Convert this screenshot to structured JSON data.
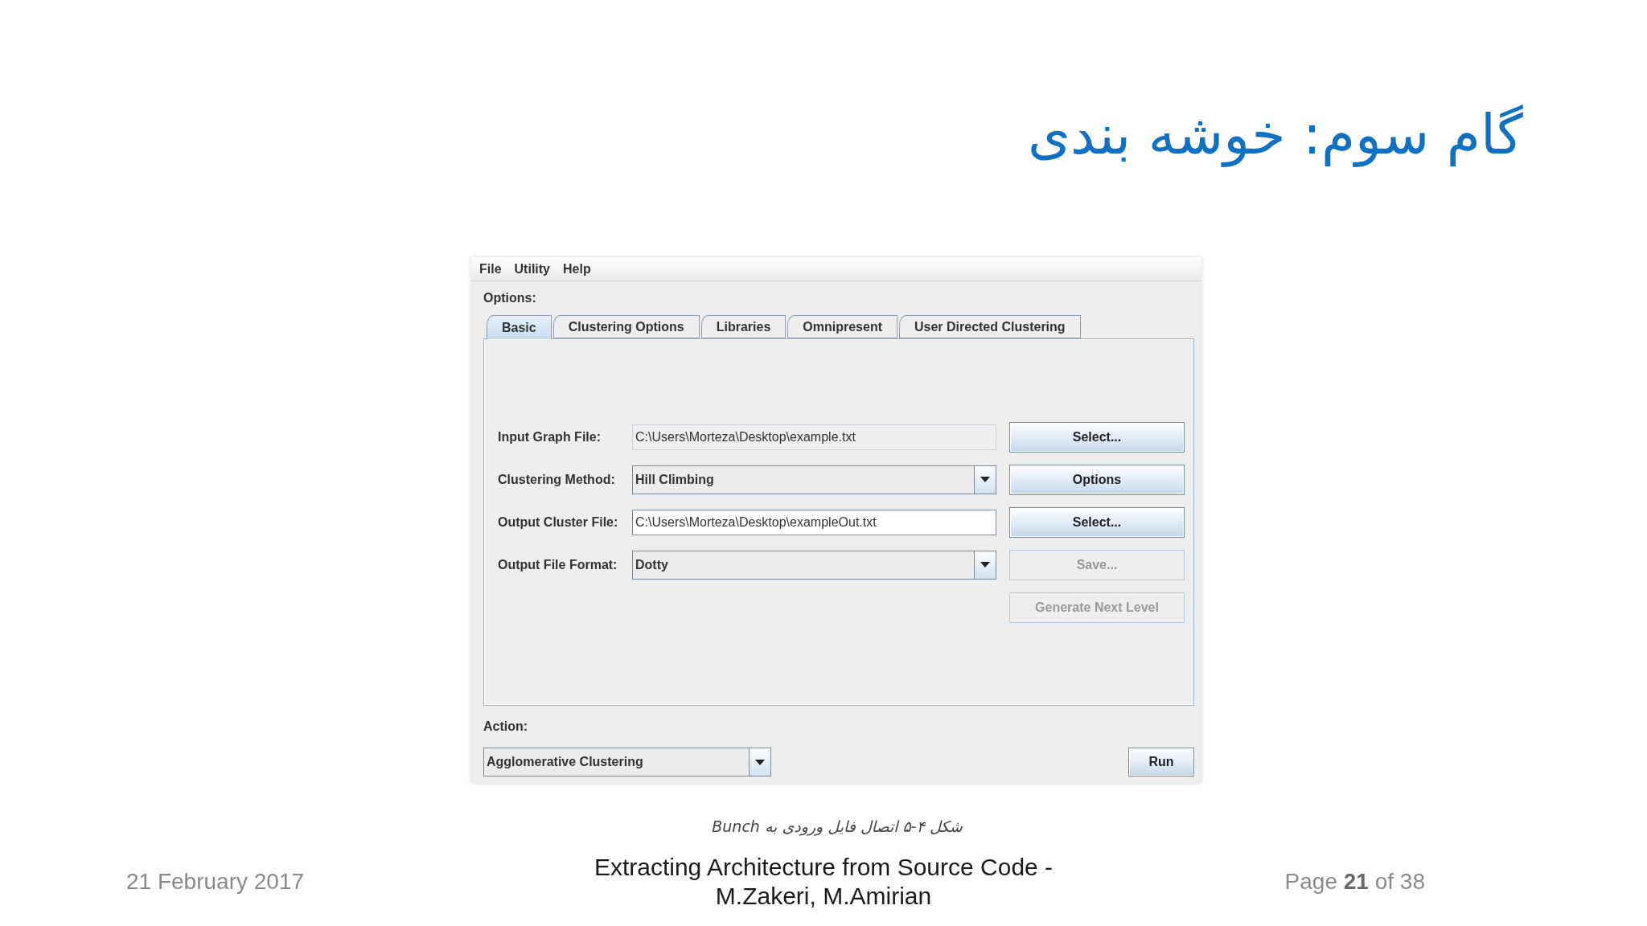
{
  "title": "گام سوم: خوشه بندی",
  "window": {
    "menu": [
      "File",
      "Utility",
      "Help"
    ],
    "options_label": "Options:",
    "tabs": [
      {
        "label": "Basic",
        "selected": true
      },
      {
        "label": "Clustering Options",
        "selected": false
      },
      {
        "label": "Libraries",
        "selected": false
      },
      {
        "label": "Omnipresent",
        "selected": false
      },
      {
        "label": "User Directed Clustering",
        "selected": false
      }
    ],
    "form_rows": [
      {
        "kind": "text",
        "label": "Input Graph File:",
        "value": "C:\\Users\\Morteza\\Desktop\\example.txt",
        "editable": false,
        "button": {
          "label": "Select...",
          "disabled": false
        }
      },
      {
        "kind": "dropdown",
        "label": "Clustering Method:",
        "value": "Hill Climbing",
        "button": {
          "label": "Options",
          "disabled": false
        }
      },
      {
        "kind": "text",
        "label": "Output Cluster File:",
        "value": "C:\\Users\\Morteza\\Desktop\\exampleOut.txt",
        "editable": true,
        "button": {
          "label": "Select...",
          "disabled": false
        }
      },
      {
        "kind": "dropdown",
        "label": "Output File Format:",
        "value": "Dotty",
        "button": {
          "label": "Save...",
          "disabled": true
        }
      },
      {
        "kind": "button",
        "button": {
          "label": "Generate Next Level",
          "disabled": true
        }
      }
    ],
    "action_label": "Action:",
    "action_dropdown": "Agglomerative Clustering",
    "run_button": "Run"
  },
  "caption": "شکل ۴-۵ اتصال فایل ورودی به Bunch",
  "footer": {
    "date": "21 February 2017",
    "title": "Extracting Architecture from Source Code - M.Zakeri, M.Amirian",
    "page": "Page **21** of 38"
  }
}
